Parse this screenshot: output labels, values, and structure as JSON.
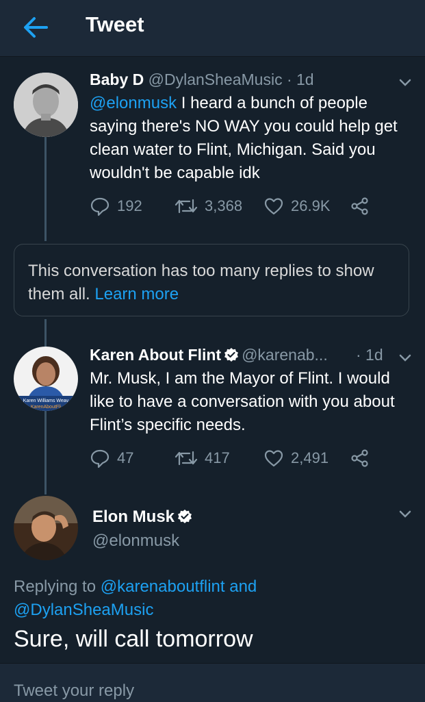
{
  "header": {
    "title": "Tweet"
  },
  "tweets": [
    {
      "name": "Baby D",
      "handle": "@DylanSheaMusic",
      "time": "· 1d",
      "mention": "@elonmusk",
      "text_after_mention": " I heard a bunch of people saying there's NO WAY you could help get clean water to Flint, Michigan. Said you wouldn't be capable idk",
      "replies": "192",
      "retweets": "3,368",
      "likes": "26.9K"
    },
    {
      "name": "Karen About Flint",
      "handle": "@karenab...",
      "time": "· 1d",
      "text": "Mr. Musk, I am the Mayor of Flint. I would like to have a conversation with you about Flint’s specific needs.",
      "avatar_caption_1": "Karen Williams Weav",
      "avatar_caption_2": "KarenAboutFli",
      "replies": "47",
      "retweets": "417",
      "likes": "2,491"
    }
  ],
  "notice": {
    "text": "This conversation has too many replies to show them all. ",
    "link": "Learn more"
  },
  "main_tweet": {
    "name": "Elon Musk",
    "handle": "@elonmusk",
    "replying_prefix": "Replying to ",
    "replying_user1": "@karenaboutflint",
    "replying_and": " and",
    "replying_user2": "@DylanSheaMusic",
    "text": "Sure, will call tomorrow"
  },
  "reply_bar": {
    "placeholder": "Tweet your reply"
  },
  "colors": {
    "background": "#15202b",
    "header": "#1c2938",
    "accent": "#1da1f2",
    "secondary_text": "#8899a6",
    "thread_line": "#3d5466"
  }
}
